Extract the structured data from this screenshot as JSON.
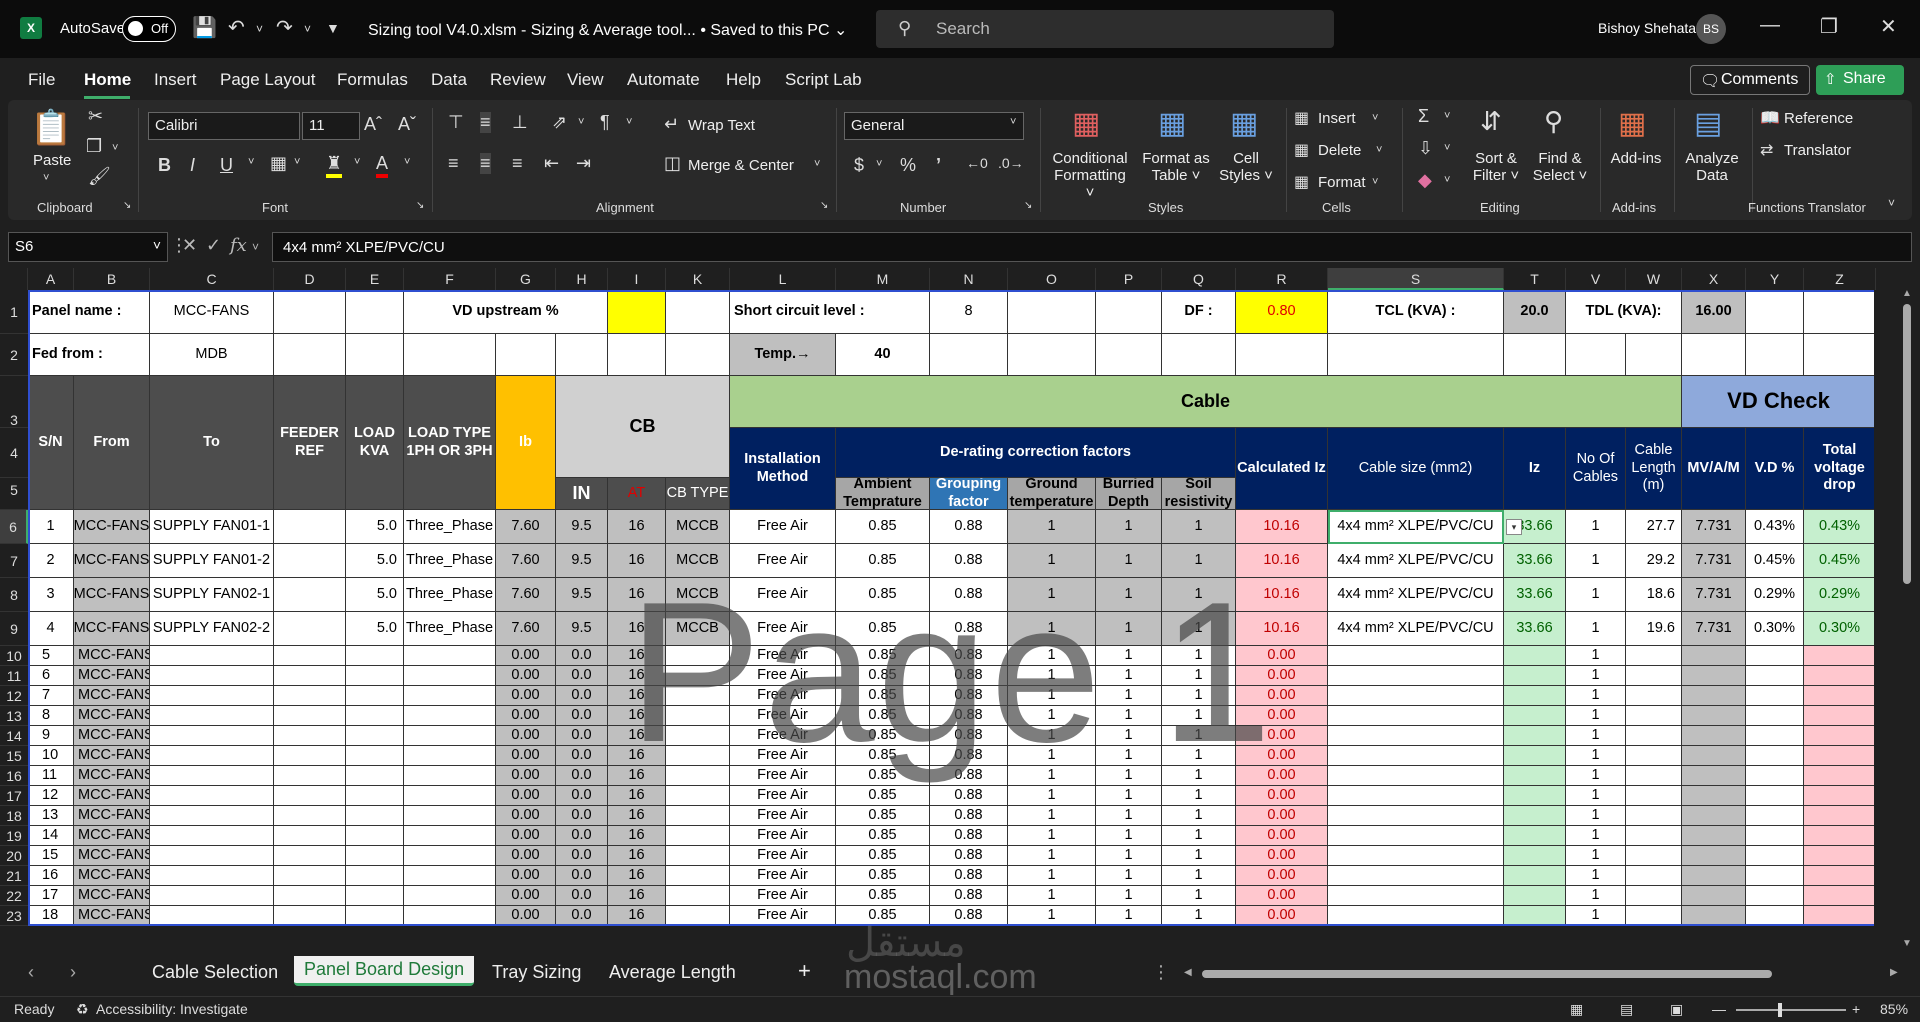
{
  "titlebar": {
    "logo": "X",
    "autosave_label": "AutoSave",
    "toggle_state": "Off",
    "doc_title": "Sizing tool V4.0.xlsm  -  Sizing & Average tool...  • Saved to this PC ⌄",
    "search_placeholder": "Search",
    "user_name": "Bishoy Shehata",
    "user_initials": "BS"
  },
  "menu": {
    "tabs": [
      "File",
      "Home",
      "Insert",
      "Page Layout",
      "Formulas",
      "Data",
      "Review",
      "View",
      "Automate",
      "Help",
      "Script Lab"
    ],
    "active_tab": "Home",
    "comments_label": "Comments",
    "share_label": "Share"
  },
  "ribbon": {
    "clipboard": {
      "label": "Clipboard",
      "paste": "Paste"
    },
    "font": {
      "label": "Font",
      "name": "Calibri",
      "size": "11"
    },
    "alignment": {
      "label": "Alignment",
      "wrap_text": "Wrap Text",
      "merge_center": "Merge & Center"
    },
    "number": {
      "label": "Number",
      "format": "General"
    },
    "styles": {
      "label": "Styles",
      "cond_fmt_1": "Conditional",
      "cond_fmt_2": "Formatting ˅",
      "fmt_table_1": "Format as",
      "fmt_table_2": "Table ˅",
      "cell_styles_1": "Cell",
      "cell_styles_2": "Styles ˅"
    },
    "cells": {
      "label": "Cells",
      "insert": "Insert",
      "delete": "Delete",
      "format": "Format"
    },
    "editing": {
      "label": "Editing",
      "sort_1": "Sort &",
      "sort_2": "Filter ˅",
      "find_1": "Find &",
      "find_2": "Select ˅"
    },
    "addins": {
      "label": "Add-ins",
      "addins": "Add-ins"
    },
    "analyze": {
      "label_1": "Analyze",
      "label_2": "Data"
    },
    "functions": {
      "label": "Functions Translator",
      "reference": "Reference",
      "translator": "Translator"
    }
  },
  "formula_bar": {
    "name_box": "S6",
    "content": "4x4 mm² XLPE/PVC/CU"
  },
  "columns": [
    "A",
    "B",
    "C",
    "D",
    "E",
    "F",
    "G",
    "H",
    "I",
    "K",
    "L",
    "M",
    "N",
    "O",
    "P",
    "Q",
    "R",
    "S",
    "T",
    "V",
    "W",
    "X",
    "Y",
    "Z"
  ],
  "selected_column": "S",
  "row_numbers": [
    "1",
    "2",
    "3",
    "4",
    "5",
    "6",
    "7",
    "8",
    "9",
    "10",
    "11",
    "12",
    "13",
    "14",
    "15",
    "16",
    "17",
    "18",
    "19",
    "20",
    "21",
    "22",
    "23"
  ],
  "selected_row": "6",
  "header": {
    "panel_name_label": "Panel name :",
    "panel_name_value": "MCC-FANS",
    "vd_upstream_label": "VD upstream %",
    "short_circuit_label": "Short circuit level :",
    "short_circuit_value": "8",
    "df_label": "DF :",
    "df_value": "0.80",
    "tcl_label": "TCL (KVA) :",
    "tcl_value": "20.0",
    "tdl_label": "TDL (KVA):",
    "tdl_value": "16.00",
    "fed_from_label": "Fed from :",
    "fed_from_value": "MDB",
    "temp_label": "Temp.→",
    "temp_value": "40"
  },
  "table_headers": {
    "sn": "S/N",
    "from": "From",
    "to": "To",
    "feeder_ref": "FEEDER REF",
    "load_kva": "LOAD KVA",
    "load_type": "LOAD TYPE 1PH OR 3PH",
    "ib": "Ib",
    "cb": "CB",
    "in": "IN",
    "at": "AT",
    "cb_type": "CB TYPE",
    "cable": "Cable",
    "installation": "Installation Method",
    "derating": "De-rating correction factors",
    "ambient": "Ambient Temprature",
    "grouping": "Grouping factor",
    "ground_temp": "Ground temperature",
    "burried": "Burried Depth",
    "soil": "Soil resistivity",
    "calc_iz": "Calculated Iz",
    "cable_size": "Cable size (mm2)",
    "iz": "Iz",
    "no_cables": "No Of Cables",
    "cable_length": "Cable Length (m)",
    "vd_check": "VD Check",
    "mva": "MV/A/M",
    "vd_pct": "V.D %",
    "total_vd": "Total voltage drop"
  },
  "rows_full": [
    {
      "sn": "1",
      "from": "MCC-FANS",
      "to": "SUPPLY FAN01-1",
      "kva": "5.0",
      "type": "Three_Phase",
      "ib": "7.60",
      "in": "9.5",
      "at": "16",
      "cbtype": "MCCB",
      "inst": "Free Air",
      "amb": "0.85",
      "grp": "0.88",
      "gt": "1",
      "bd": "1",
      "sr": "1",
      "ciz": "10.16",
      "size": "4x4 mm² XLPE/PVC/CU",
      "iz": "33.66",
      "noc": "1",
      "len": "27.7",
      "mva": "7.731",
      "vd": "0.43%",
      "tvd": "0.43%"
    },
    {
      "sn": "2",
      "from": "MCC-FANS",
      "to": "SUPPLY FAN01-2",
      "kva": "5.0",
      "type": "Three_Phase",
      "ib": "7.60",
      "in": "9.5",
      "at": "16",
      "cbtype": "MCCB",
      "inst": "Free Air",
      "amb": "0.85",
      "grp": "0.88",
      "gt": "1",
      "bd": "1",
      "sr": "1",
      "ciz": "10.16",
      "size": "4x4 mm² XLPE/PVC/CU",
      "iz": "33.66",
      "noc": "1",
      "len": "29.2",
      "mva": "7.731",
      "vd": "0.45%",
      "tvd": "0.45%"
    },
    {
      "sn": "3",
      "from": "MCC-FANS",
      "to": "SUPPLY FAN02-1",
      "kva": "5.0",
      "type": "Three_Phase",
      "ib": "7.60",
      "in": "9.5",
      "at": "16",
      "cbtype": "MCCB",
      "inst": "Free Air",
      "amb": "0.85",
      "grp": "0.88",
      "gt": "1",
      "bd": "1",
      "sr": "1",
      "ciz": "10.16",
      "size": "4x4 mm² XLPE/PVC/CU",
      "iz": "33.66",
      "noc": "1",
      "len": "18.6",
      "mva": "7.731",
      "vd": "0.29%",
      "tvd": "0.29%"
    },
    {
      "sn": "4",
      "from": "MCC-FANS",
      "to": "SUPPLY FAN02-2",
      "kva": "5.0",
      "type": "Three_Phase",
      "ib": "7.60",
      "in": "9.5",
      "at": "16",
      "cbtype": "MCCB",
      "inst": "Free Air",
      "amb": "0.85",
      "grp": "0.88",
      "gt": "1",
      "bd": "1",
      "sr": "1",
      "ciz": "10.16",
      "size": "4x4 mm² XLPE/PVC/CU",
      "iz": "33.66",
      "noc": "1",
      "len": "19.6",
      "mva": "7.731",
      "vd": "0.30%",
      "tvd": "0.30%"
    }
  ],
  "rows_empty": [
    {
      "sn": "5"
    },
    {
      "sn": "6"
    },
    {
      "sn": "7"
    },
    {
      "sn": "8"
    },
    {
      "sn": "9"
    },
    {
      "sn": "10"
    },
    {
      "sn": "11"
    },
    {
      "sn": "12"
    },
    {
      "sn": "13"
    },
    {
      "sn": "14"
    },
    {
      "sn": "15"
    },
    {
      "sn": "16"
    },
    {
      "sn": "17"
    },
    {
      "sn": "18"
    }
  ],
  "empty_defaults": {
    "from": "MCC-FANS",
    "ib": "0.00",
    "in": "0.0",
    "at": "16",
    "inst": "Free Air",
    "amb": "0.85",
    "grp": "0.88",
    "gt": "1",
    "bd": "1",
    "sr": "1",
    "ciz": "0.00",
    "noc": "1"
  },
  "watermark": "Page 1",
  "sheet_tabs": [
    "Cable Selection",
    "Panel Board Design",
    "Tray Sizing",
    "Average Length"
  ],
  "active_sheet": "Panel Board Design",
  "status": {
    "ready": "Ready",
    "accessibility": "Accessibility: Investigate",
    "zoom": "85%"
  },
  "site_watermark": "mostaql.com",
  "site_watermark_ar": "مستقل",
  "colors": {
    "yellow": "#ffff00",
    "ib": "#ffc000",
    "green_header": "#a9d08e",
    "navy": "#002060",
    "vd_header": "#8ea9db",
    "gray": "#bfbfbf",
    "pink": "#ffc7ce",
    "light_green": "#c6efce",
    "blue_grouping": "#2f75b5"
  }
}
